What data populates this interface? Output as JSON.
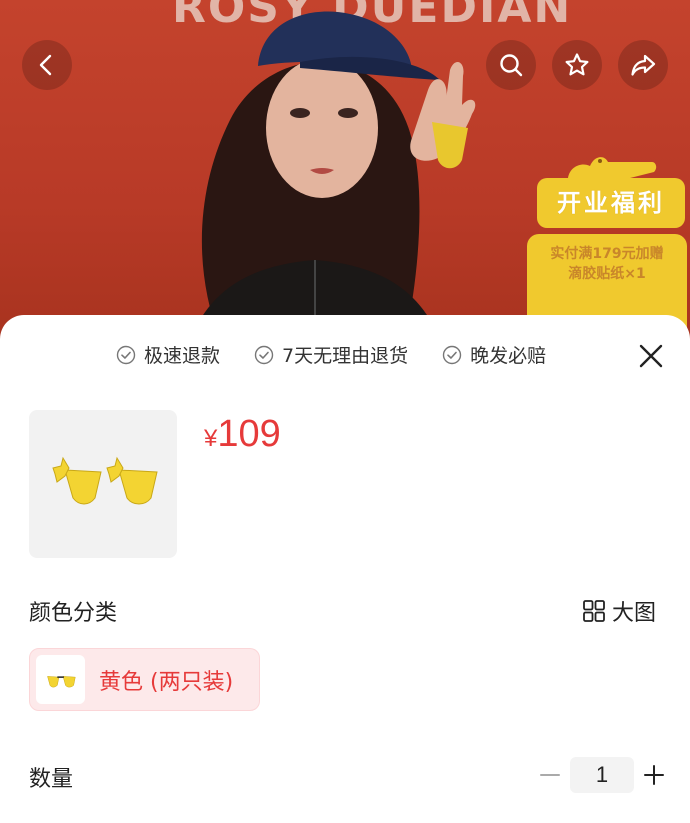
{
  "hero": {
    "brand_text": "ROSY DUEDIAN",
    "promo": {
      "title": "开业福利",
      "line1": "实付满179元加赠",
      "line2": "滴胶贴纸×1"
    }
  },
  "header_icons": {
    "back": "back-chevron-icon",
    "search": "search-icon",
    "favorite": "star-icon",
    "share": "share-icon"
  },
  "guarantees": [
    "极速退款",
    "7天无理由退货",
    "晚发必赔"
  ],
  "product": {
    "currency": "¥",
    "price": "109"
  },
  "color_section": {
    "label": "颜色分类",
    "view_large": "大图",
    "options": [
      {
        "label": "黄色 (两只装)",
        "selected": true
      }
    ]
  },
  "quantity": {
    "label": "数量",
    "value": "1"
  },
  "colors": {
    "accent": "#e63a3a",
    "option_bg": "#fde9ea",
    "hero_bg": "#c4432d",
    "promo_yellow": "#f0c92e",
    "product_yellow": "#f3d432"
  }
}
